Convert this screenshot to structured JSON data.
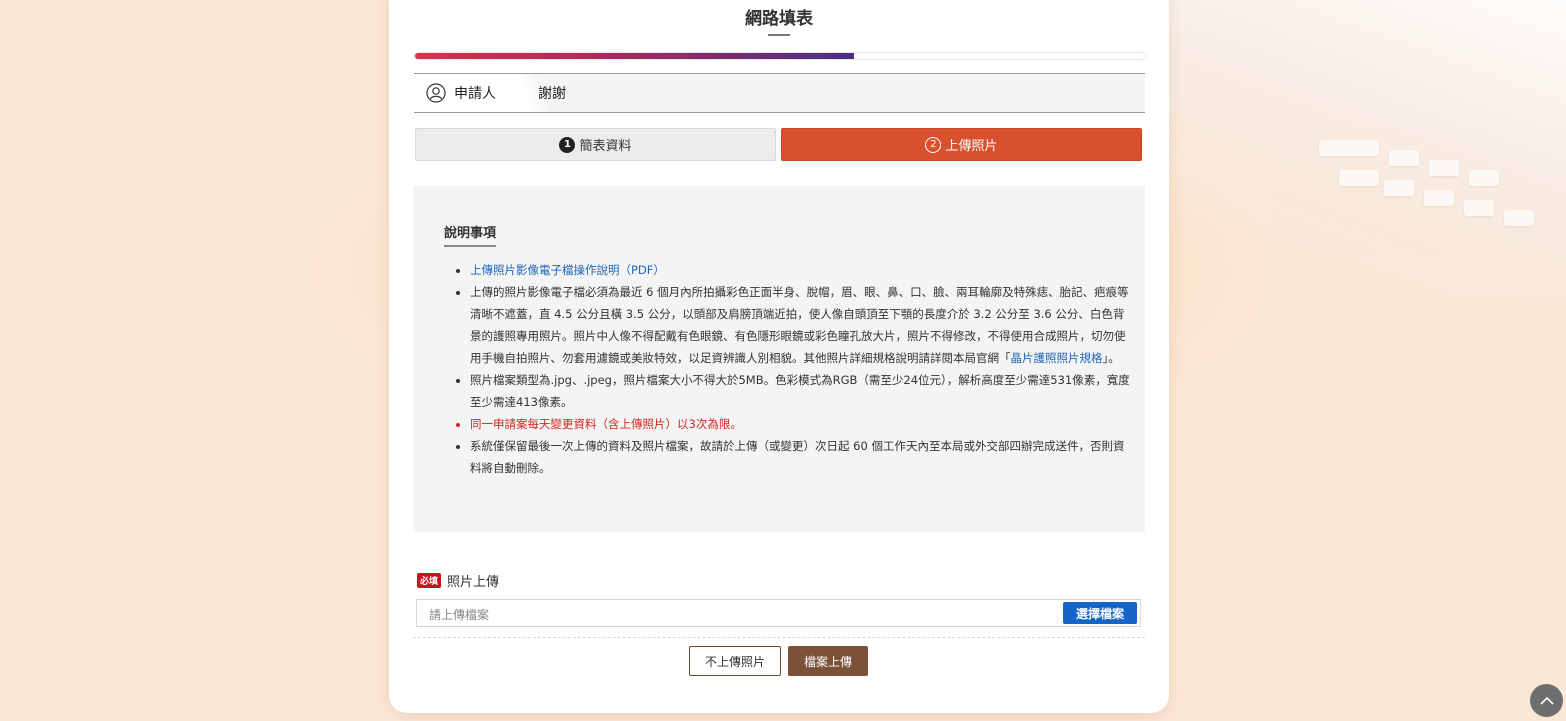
{
  "page": {
    "title": "網路填表"
  },
  "progress": {
    "percent": 60
  },
  "app_tabs": [
    {
      "label": "申請人"
    },
    {
      "label": "謝謝"
    }
  ],
  "steps": [
    {
      "number": "1",
      "label": "簡表資料"
    },
    {
      "number": "2",
      "label": "上傳照片"
    }
  ],
  "notice": {
    "title": "說明事項",
    "link1": "上傳照片影像電子檔操作說明（PDF）",
    "item2_text": "上傳的照片影像電子檔必須為最近 6 個月內所拍攝彩色正面半身、脫帽，眉、眼、鼻、口、臉、兩耳輪廓及特殊痣、胎記、疤痕等清晰不遮蓋，直 4.5 公分且橫 3.5 公分，以頭部及肩膀頂端近拍，使人像自頭頂至下顎的長度介於 3.2 公分至 3.6 公分、白色背景的護照專用照片。照片中人像不得配戴有色眼鏡、有色隱形眼鏡或彩色瞳孔放大片，照片不得修改，不得使用合成照片，切勿使用手機自拍照片、勿套用濾鏡或美妝特效，以足資辨識人別相貌。其他照片詳細規格說明請詳閱本局官網「",
    "item2_link": "晶片護照照片規格",
    "item2_suffix": "」。",
    "item3": "照片檔案類型為.jpg、.jpeg，照片檔案大小不得大於5MB。色彩模式為RGB（需至少24位元），解析高度至少需達531像素，寬度至少需達413像素。",
    "item4": "同一申請案每天變更資料（含上傳照片）以3次為限。",
    "item5": "系統僅保留最後一次上傳的資料及照片檔案，故請於上傳（或變更）次日起 60 個工作天內至本局或外交部四辦完成送件，否則資料將自動刪除。"
  },
  "upload": {
    "required_badge": "必填",
    "label": "照片上傳",
    "placeholder": "請上傳檔案",
    "choose_label": "選擇檔案"
  },
  "buttons": {
    "skip_label": "不上傳照片",
    "upload_label": "檔案上傳"
  },
  "colors": {
    "accent": "#d9502f",
    "brown": "#7b5138",
    "link": "#1e64b4",
    "warning": "#d0261f",
    "primary_blue": "#1565c8"
  }
}
